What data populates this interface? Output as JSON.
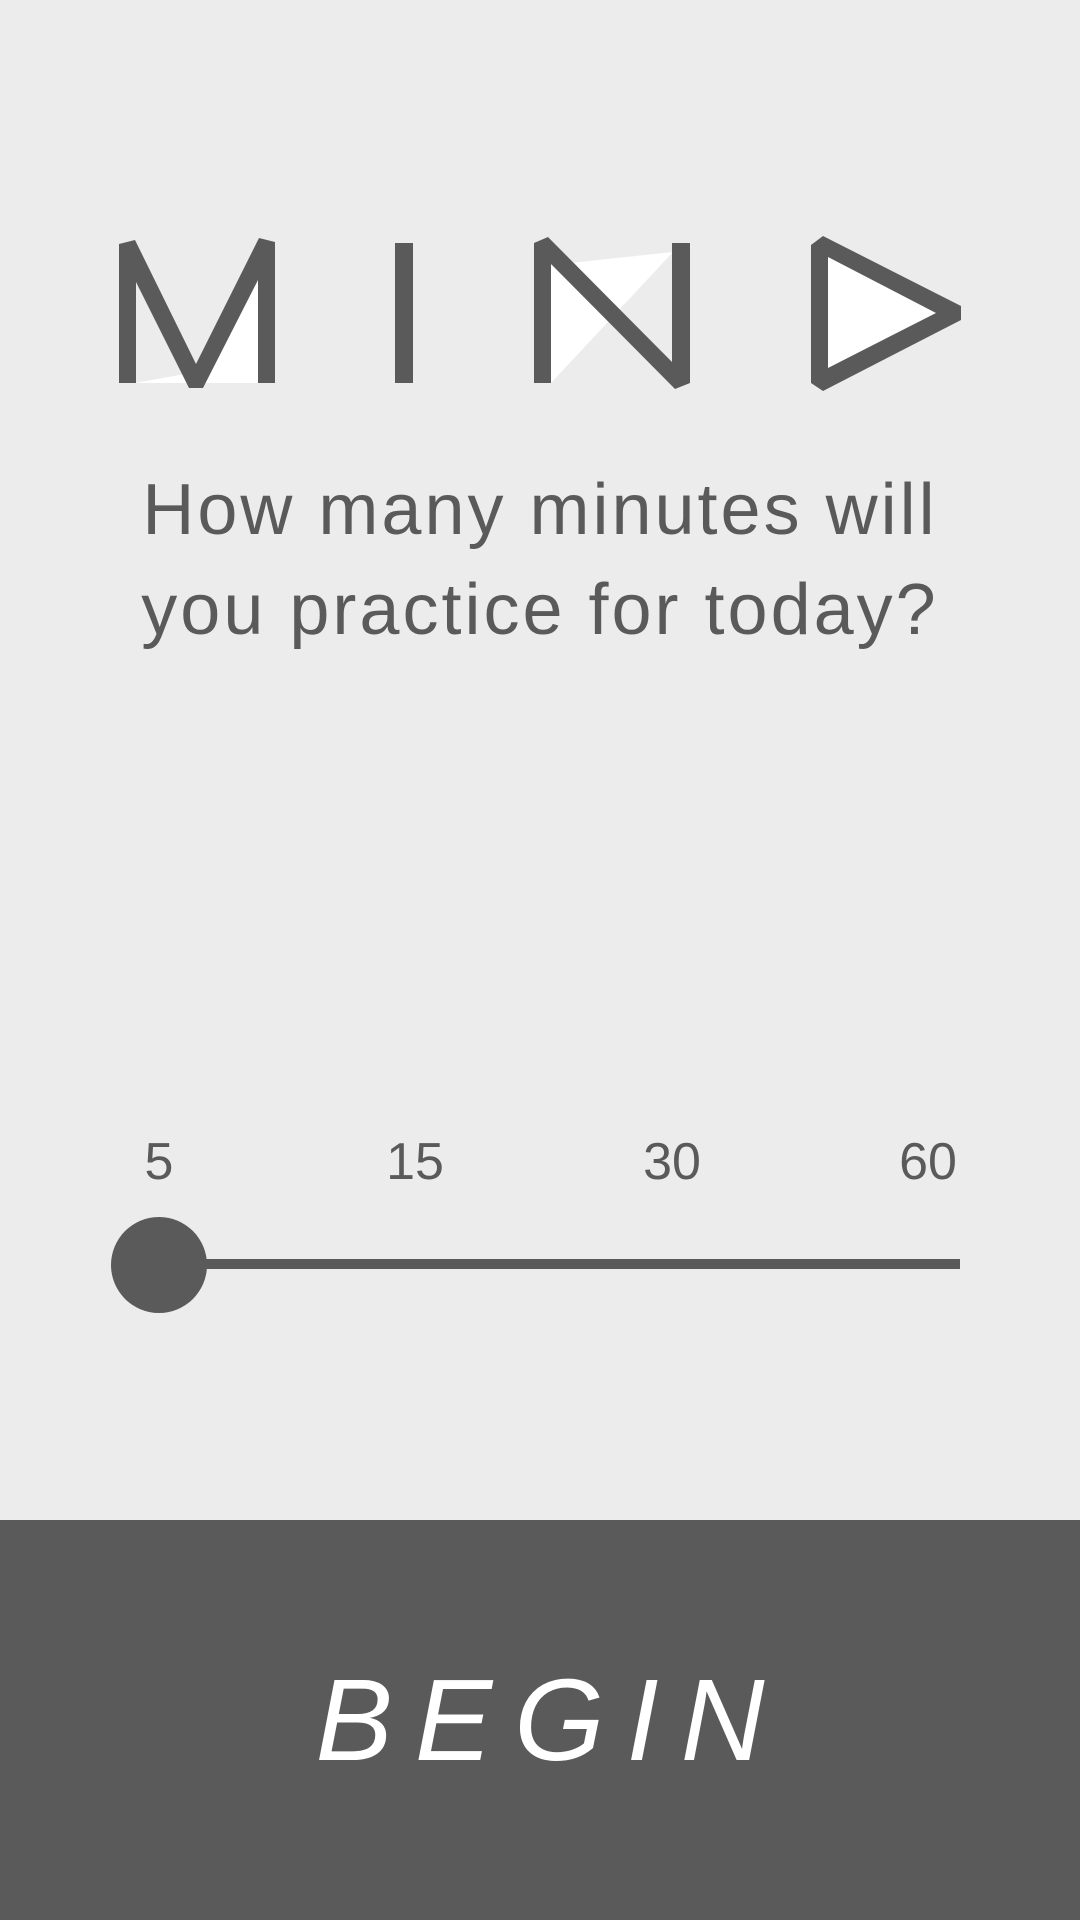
{
  "logo": {
    "text": "MIND",
    "icon": "mind-logo-icon"
  },
  "question": {
    "line1": "How many minutes will",
    "line2": "you practice for today?"
  },
  "slider": {
    "ticks": [
      "5",
      "15",
      "30",
      "60"
    ],
    "selected_value": "5",
    "selected_index": 0
  },
  "begin_button": {
    "label": "BEGIN"
  },
  "colors": {
    "background": "#ececec",
    "primary": "#5a5a5a",
    "button_text": "#ffffff",
    "logo_fill": "#ffffff"
  }
}
